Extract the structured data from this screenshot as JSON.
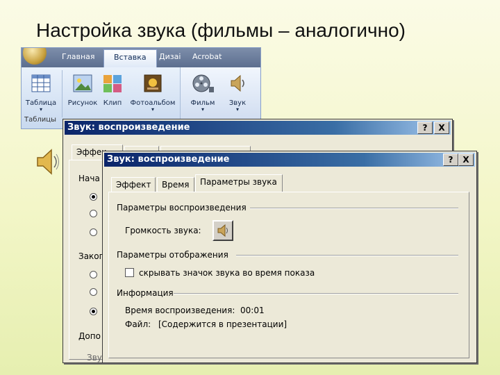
{
  "slide": {
    "title": "Настройка звука (фильмы – аналогично)"
  },
  "ribbon": {
    "tabs": [
      "Главная",
      "Вставка",
      "Дизаі",
      "Acrobat"
    ],
    "active_tab": "Вставка",
    "buttons": {
      "table": "Таблица",
      "picture": "Рисунок",
      "clip": "Клип",
      "photo_album": "Фотоальбом",
      "movie": "Фильм",
      "sound": "Звук"
    },
    "group_tables": "Таблицы"
  },
  "dialog_back": {
    "title": "Звук: воспроизведение",
    "help_btn": "?",
    "close_btn": "X",
    "tab_effect": "Эффек",
    "label_start": "Нача",
    "label_end": "Заког",
    "label_extra": "Допо",
    "label_cut": "Звук"
  },
  "dialog_front": {
    "title": "Звук: воспроизведение",
    "help_btn": "?",
    "close_btn": "X",
    "tabs": [
      "Эффект",
      "Время",
      "Параметры звука"
    ],
    "active_tab": "Параметры звука",
    "section_playback": "Параметры воспроизведения",
    "volume_label": "Громкость звука:",
    "section_display": "Параметры отображения",
    "hide_icon_label": "скрывать значок звука во время показа",
    "hide_icon_checked": false,
    "section_info": "Информация",
    "duration_label": "Время воспроизведения:",
    "duration_value": "00:01",
    "file_label": "Файл:",
    "file_value": "[Содержится в презентации]"
  }
}
